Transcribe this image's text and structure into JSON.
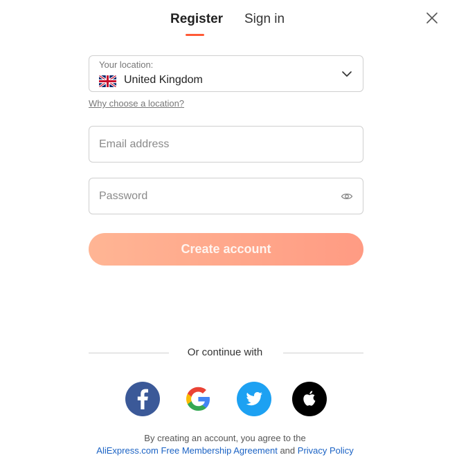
{
  "tabs": {
    "register": "Register",
    "signin": "Sign in"
  },
  "location": {
    "label": "Your location:",
    "value": "United Kingdom",
    "why_link": "Why choose a location?"
  },
  "email": {
    "placeholder": "Email address"
  },
  "password": {
    "placeholder": "Password"
  },
  "create_button": "Create account",
  "continue_with": "Or continue with",
  "terms": {
    "prefix": "By creating an account, you agree to the",
    "agreement_link": "AliExpress.com Free Membership Agreement",
    "and": "and",
    "privacy_link": "Privacy Policy"
  },
  "icons": {
    "close": "close-icon",
    "chevron": "chevron-down-icon",
    "eye": "eye-icon",
    "flag": "uk-flag-icon",
    "facebook": "facebook-icon",
    "google": "google-icon",
    "twitter": "twitter-icon",
    "apple": "apple-icon"
  },
  "colors": {
    "accent": "#ff5a36",
    "link": "#1a62c4",
    "button_start": "#ffb594",
    "button_end": "#ff9b83",
    "facebook": "#3b5998",
    "twitter": "#1da1f2"
  }
}
